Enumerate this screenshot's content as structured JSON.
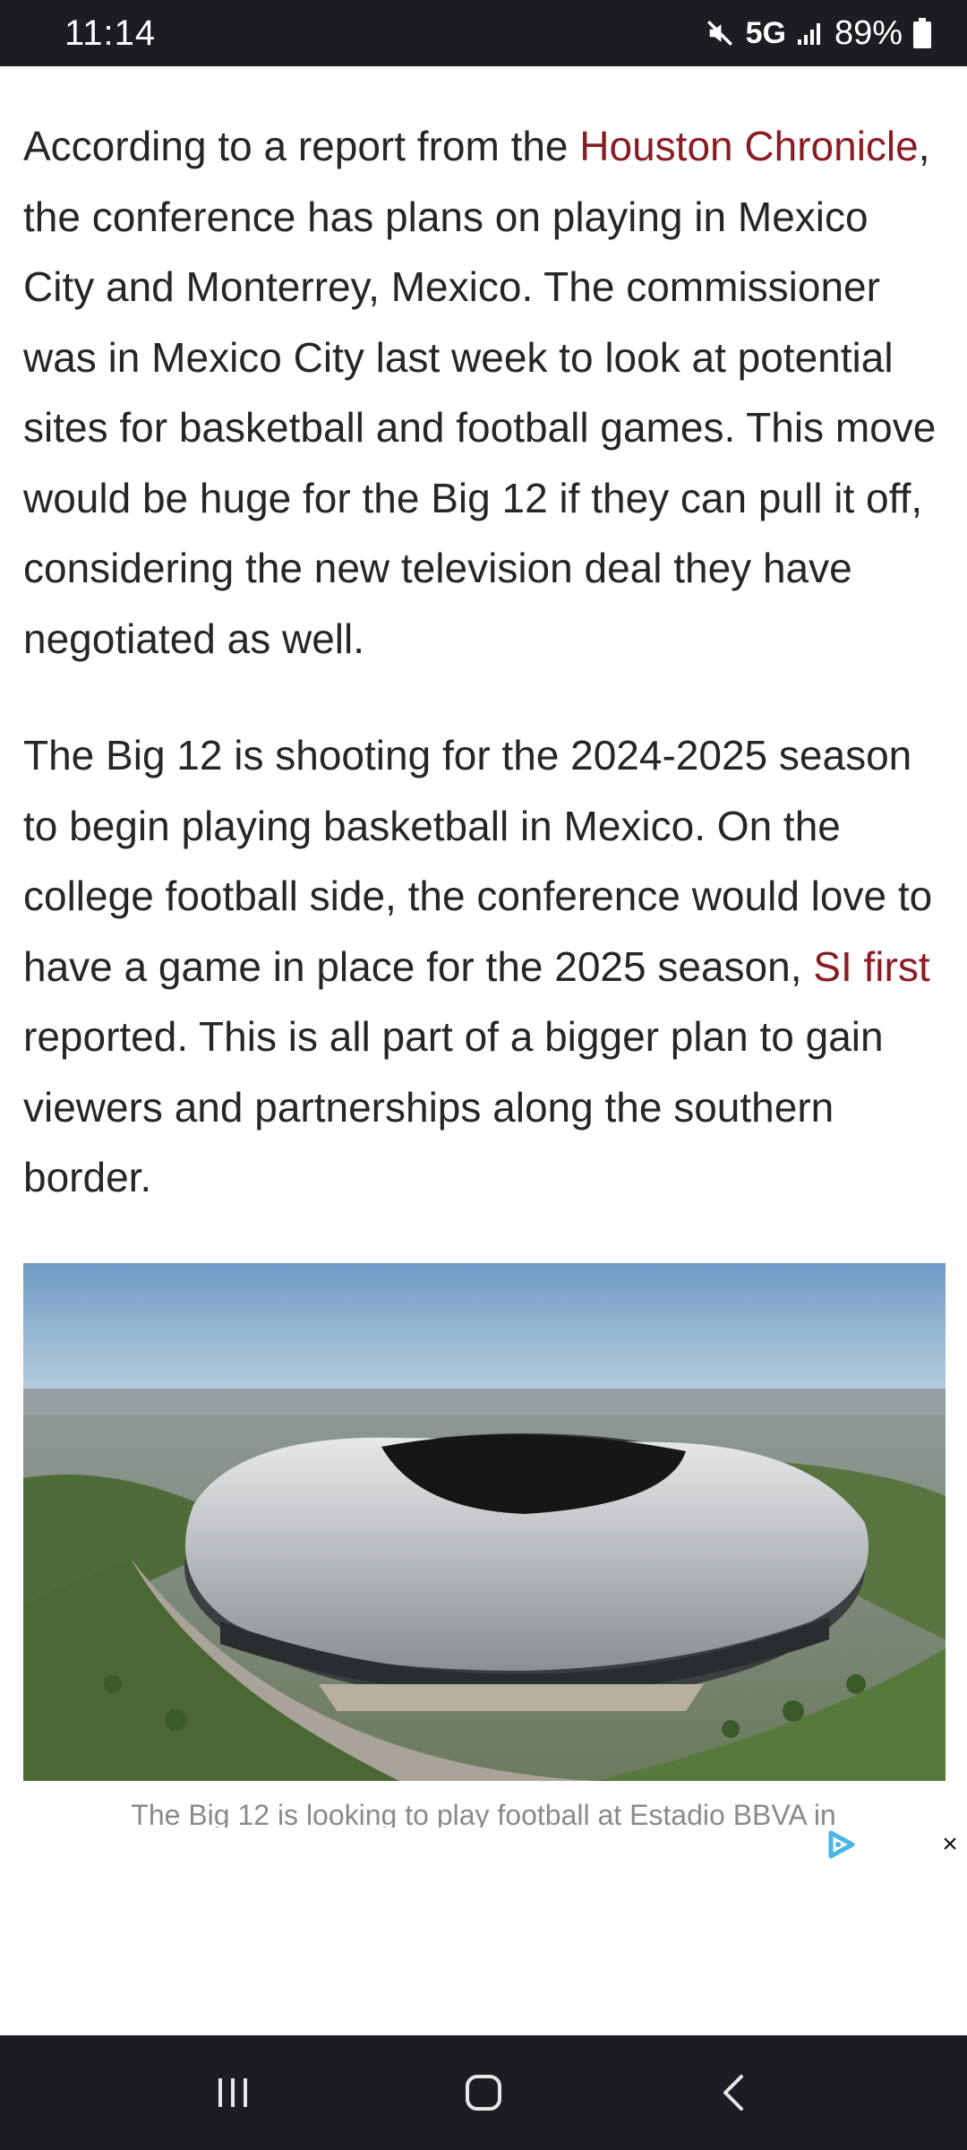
{
  "status_bar": {
    "time": "11:14",
    "network": "5G",
    "battery": "89%",
    "icons": [
      "mute-icon",
      "signal-icon",
      "battery-icon"
    ]
  },
  "article": {
    "paragraph1": {
      "before_link": "According to a report from the ",
      "link": "Houston Chronicle",
      "after_link": ", the conference has plans on playing in Mexico City and Monterrey, Mexico. The commissioner was in Mexico City last week to look at potential sites for basketball and football games. This move would be huge for the Big 12 if they can pull it off, considering the new television deal they have negotiated as well."
    },
    "paragraph2": {
      "before_link": "The Big 12 is shooting for the 2024-2025 season to begin playing basketball in Mexico. On the college football side, the conference would love to have a game in place for the 2025 season, ",
      "link": "SI first",
      "after_link": " reported. This is all part of a bigger plan to gain viewers and partnerships along the southern border."
    },
    "image_caption": "The Big 12 is looking to play football at Estadio BBVA in",
    "link_color": "#8b1c23"
  },
  "ad": {
    "close_label": "×",
    "choices_icon": "ad-choices-icon"
  },
  "nav_bar": {
    "buttons": [
      "recent-apps-icon",
      "home-icon",
      "back-icon"
    ]
  }
}
